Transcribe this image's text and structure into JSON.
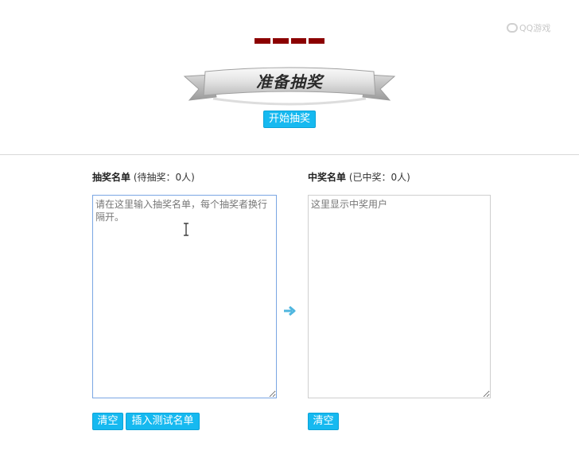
{
  "watermark": {
    "text": "QQ游戏"
  },
  "display": {
    "placeholder_dashes": 4
  },
  "banner": {
    "title": "准备抽奖"
  },
  "controls": {
    "start_label": "开始抽奖"
  },
  "left_panel": {
    "title": "抽奖名单",
    "count_text": "(待抽奖：0人)",
    "placeholder": "请在这里输入抽奖名单，每个抽奖者换行隔开。",
    "clear_label": "清空",
    "insert_label": "插入测试名单"
  },
  "right_panel": {
    "title": "中奖名单",
    "count_text": "(已中奖：0人)",
    "placeholder": "这里显示中奖用户",
    "clear_label": "清空"
  },
  "colors": {
    "accent": "#16b9f0",
    "dash": "#8b0000",
    "focus_border": "#7aa6e3"
  },
  "icons": {
    "transfer": "arrow-right-icon",
    "cursor": "text-cursor-icon"
  }
}
